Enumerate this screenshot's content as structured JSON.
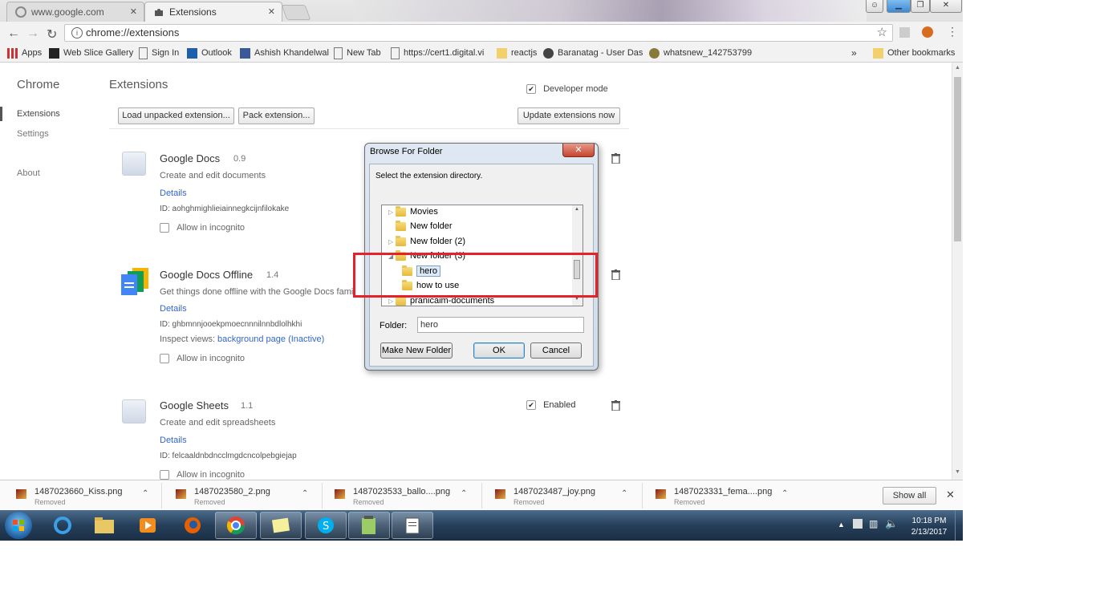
{
  "browser": {
    "tabs": [
      {
        "title": "www.google.com",
        "active": false
      },
      {
        "title": "Extensions",
        "active": true
      }
    ],
    "url": "chrome://extensions",
    "bookmarks": [
      {
        "label": "Apps",
        "icon": "apps-grid-icon"
      },
      {
        "label": "Web Slice Gallery",
        "icon": "web-slice-icon"
      },
      {
        "label": "Sign In",
        "icon": "page-icon"
      },
      {
        "label": "Outlook",
        "icon": "mail-icon"
      },
      {
        "label": "Ashish Khandelwal",
        "icon": "facebook-icon"
      },
      {
        "label": "New Tab",
        "icon": "page-icon"
      },
      {
        "label": "https://cert1.digital.vi",
        "icon": "page-icon"
      },
      {
        "label": "reactjs",
        "icon": "folder-icon"
      },
      {
        "label": "Baranatag - User Das",
        "icon": "site-icon"
      },
      {
        "label": "whatsnew_142753799",
        "icon": "site-icon"
      }
    ],
    "bookmarks_overflow": "»",
    "other_bookmarks": "Other bookmarks"
  },
  "sidebar": {
    "title": "Chrome",
    "items": [
      {
        "label": "Extensions",
        "selected": true
      },
      {
        "label": "Settings",
        "selected": false
      },
      {
        "label": "About",
        "selected": false
      }
    ]
  },
  "main": {
    "title": "Extensions",
    "developer_mode_label": "Developer mode",
    "developer_mode_checked": true,
    "load_unpacked_label": "Load unpacked extension...",
    "pack_label": "Pack extension...",
    "update_label": "Update extensions now",
    "extensions": [
      {
        "name": "Google Docs",
        "version": "0.9",
        "description": "Create and edit documents",
        "details": "Details",
        "id": "ID: aohghmighlieiainnegkcijnfilokake",
        "incognito": "Allow in incognito"
      },
      {
        "name": "Google Docs Offline",
        "version": "1.4",
        "description": "Get things done offline with the Google Docs fami",
        "details": "Details",
        "id": "ID: ghbmnnjooekpmoecnnnilnnbdlolhkhi",
        "inspect_label": "Inspect views:",
        "inspect_link": "background page (Inactive)",
        "incognito": "Allow in incognito"
      },
      {
        "name": "Google Sheets",
        "version": "1.1",
        "description": "Create and edit spreadsheets",
        "details": "Details",
        "id": "ID: felcaaldnbdncclmgdcncolpebgiejap",
        "incognito": "Allow in incognito",
        "enabled_label": "Enabled",
        "enabled": true
      }
    ]
  },
  "dialog": {
    "title": "Browse For Folder",
    "close": "✕",
    "instruction": "Select the extension directory.",
    "tree": [
      {
        "label": "Movies",
        "expandable": true,
        "indent": 0
      },
      {
        "label": "New folder",
        "expandable": false,
        "indent": 0
      },
      {
        "label": "New folder (2)",
        "expandable": true,
        "indent": 0
      },
      {
        "label": "New folder (3)",
        "expandable": true,
        "indent": 0
      },
      {
        "label": "hero",
        "expandable": false,
        "indent": 1,
        "selected": true
      },
      {
        "label": "how to use",
        "expandable": false,
        "indent": 1
      },
      {
        "label": "pranicaim-documents",
        "expandable": true,
        "indent": 0
      }
    ],
    "folder_label": "Folder:",
    "folder_value": "hero",
    "make_new_folder": "Make New Folder",
    "ok": "OK",
    "cancel": "Cancel"
  },
  "downloads": {
    "items": [
      {
        "name": "1487023660_Kiss.png",
        "status": "Removed"
      },
      {
        "name": "1487023580_2.png",
        "status": "Removed"
      },
      {
        "name": "1487023533_ballo....png",
        "status": "Removed"
      },
      {
        "name": "1487023487_joy.png",
        "status": "Removed"
      },
      {
        "name": "1487023331_fema....png",
        "status": "Removed"
      }
    ],
    "show_all": "Show all"
  },
  "taskbar": {
    "time": "10:18 PM",
    "date": "2/13/2017"
  },
  "colors": {
    "highlight_box": "#e52129",
    "link": "#3366cc"
  }
}
